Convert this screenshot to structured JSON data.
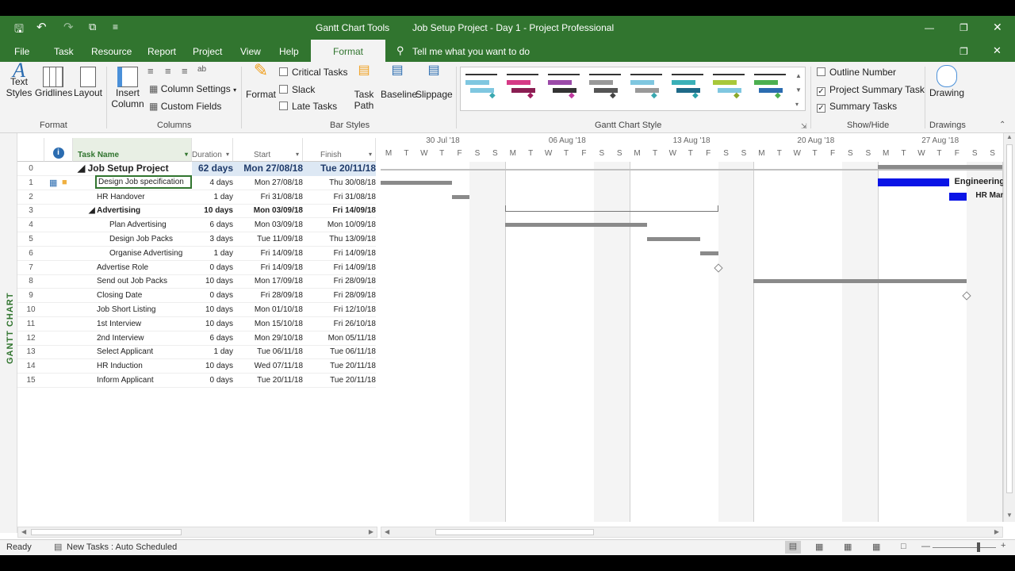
{
  "title": {
    "tools": "Gantt Chart Tools",
    "window": "Job Setup Project - Day 1  -  Project Professional"
  },
  "tabs": [
    "File",
    "Task",
    "Resource",
    "Report",
    "Project",
    "View",
    "Help",
    "Format"
  ],
  "tell_me": "Tell me what you want to do",
  "ribbon": {
    "text_styles": "Text\nStyles",
    "gridlines": "Gridlines",
    "layout": "Layout",
    "group_format": "Format",
    "insert_column": "Insert\nColumn",
    "column_settings": "Column Settings",
    "custom_fields": "Custom Fields",
    "group_columns": "Columns",
    "format": "Format",
    "critical_tasks": "Critical Tasks",
    "slack": "Slack",
    "late_tasks": "Late Tasks",
    "task_path": "Task\nPath",
    "baseline": "Baseline",
    "slippage": "Slippage",
    "group_bar_styles": "Bar Styles",
    "group_gantt_style": "Gantt Chart Style",
    "outline_number": "Outline Number",
    "project_summary_task": "Project Summary Task",
    "summary_tasks": "Summary Tasks",
    "group_show_hide": "Show/Hide",
    "drawing": "Drawing",
    "group_drawings": "Drawings"
  },
  "side_label": "GANTT CHART",
  "columns": {
    "task_name": "Task Name",
    "duration": "Duration",
    "start": "Start",
    "finish": "Finish"
  },
  "tasks": [
    {
      "id": "0",
      "name": "Job Setup Project",
      "duration": "62 days",
      "start": "Mon 27/08/18",
      "finish": "Tue 20/11/18",
      "level": 0,
      "summary": true,
      "project": true
    },
    {
      "id": "1",
      "name": "Design Job specification",
      "duration": "4 days",
      "start": "Mon 27/08/18",
      "finish": "Thu 30/08/18",
      "level": 1
    },
    {
      "id": "2",
      "name": "HR Handover",
      "duration": "1 day",
      "start": "Fri 31/08/18",
      "finish": "Fri 31/08/18",
      "level": 1
    },
    {
      "id": "3",
      "name": "Advertising",
      "duration": "10 days",
      "start": "Mon 03/09/18",
      "finish": "Fri 14/09/18",
      "level": 1,
      "summary": true
    },
    {
      "id": "4",
      "name": "Plan Advertising",
      "duration": "6 days",
      "start": "Mon 03/09/18",
      "finish": "Mon 10/09/18",
      "level": 2
    },
    {
      "id": "5",
      "name": "Design Job Packs",
      "duration": "3 days",
      "start": "Tue 11/09/18",
      "finish": "Thu 13/09/18",
      "level": 2
    },
    {
      "id": "6",
      "name": "Organise Advertising",
      "duration": "1 day",
      "start": "Fri 14/09/18",
      "finish": "Fri 14/09/18",
      "level": 2
    },
    {
      "id": "7",
      "name": "Advertise Role",
      "duration": "0 days",
      "start": "Fri 14/09/18",
      "finish": "Fri 14/09/18",
      "level": 1
    },
    {
      "id": "8",
      "name": "Send out Job Packs",
      "duration": "10 days",
      "start": "Mon 17/09/18",
      "finish": "Fri 28/09/18",
      "level": 1
    },
    {
      "id": "9",
      "name": "Closing Date",
      "duration": "0 days",
      "start": "Fri 28/09/18",
      "finish": "Fri 28/09/18",
      "level": 1
    },
    {
      "id": "10",
      "name": "Job Short Listing",
      "duration": "10 days",
      "start": "Mon 01/10/18",
      "finish": "Fri 12/10/18",
      "level": 1
    },
    {
      "id": "11",
      "name": "1st Interview",
      "duration": "10 days",
      "start": "Mon 15/10/18",
      "finish": "Fri 26/10/18",
      "level": 1
    },
    {
      "id": "12",
      "name": "2nd Interview",
      "duration": "6 days",
      "start": "Mon 29/10/18",
      "finish": "Mon 05/11/18",
      "level": 1
    },
    {
      "id": "13",
      "name": "Select Applicant",
      "duration": "1 day",
      "start": "Tue 06/11/18",
      "finish": "Tue 06/11/18",
      "level": 1
    },
    {
      "id": "14",
      "name": "HR Induction",
      "duration": "10 days",
      "start": "Wed 07/11/18",
      "finish": "Tue 20/11/18",
      "level": 1
    },
    {
      "id": "15",
      "name": "Inform Applicant",
      "duration": "0 days",
      "start": "Tue 20/11/18",
      "finish": "Tue 20/11/18",
      "level": 1
    }
  ],
  "timescale": {
    "weeks": [
      "30 Jul '18",
      "06 Aug '18",
      "13 Aug '18",
      "20 Aug '18",
      "27 Aug '18"
    ],
    "days": [
      "M",
      "T",
      "W",
      "T",
      "F",
      "S",
      "S"
    ]
  },
  "bar_labels": {
    "engineering": "Engineering",
    "hr": "HR Man"
  },
  "status": {
    "ready": "Ready",
    "mode": "New Tasks : Auto Scheduled"
  },
  "colors": {
    "accent": "#31752f",
    "task_bar": "#8a8a8a",
    "selected_bar": "#0a14e6"
  }
}
